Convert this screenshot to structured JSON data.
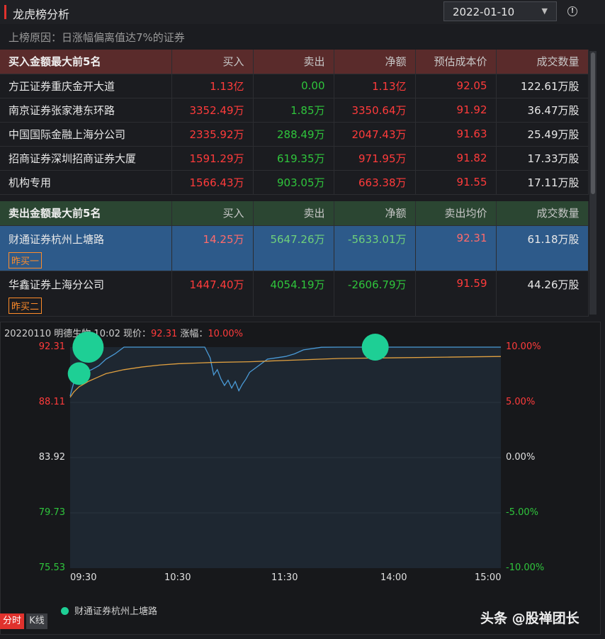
{
  "header": {
    "title": "龙虎榜分析",
    "date": "2022-01-10"
  },
  "reason": "上榜原因：日涨幅偏离值达7%的证券",
  "buy_table": {
    "columns": [
      "买入金额最大前5名",
      "买入",
      "卖出",
      "净额",
      "预估成本价",
      "成交数量"
    ],
    "rows": [
      [
        "方正证券重庆金开大道",
        "1.13亿",
        "0.00",
        "1.13亿",
        "92.05",
        "122.61万股"
      ],
      [
        "南京证券张家港东环路",
        "3352.49万",
        "1.85万",
        "3350.64万",
        "91.92",
        "36.47万股"
      ],
      [
        "中国国际金融上海分公司",
        "2335.92万",
        "288.49万",
        "2047.43万",
        "91.63",
        "25.49万股"
      ],
      [
        "招商证券深圳招商证券大厦",
        "1591.29万",
        "619.35万",
        "971.95万",
        "91.82",
        "17.33万股"
      ],
      [
        "机构专用",
        "1566.43万",
        "903.05万",
        "663.38万",
        "91.55",
        "17.11万股"
      ]
    ]
  },
  "sell_table": {
    "columns": [
      "卖出金额最大前5名",
      "买入",
      "卖出",
      "净额",
      "卖出均价",
      "成交数量"
    ],
    "rows": [
      [
        "财通证券杭州上塘路",
        "14.25万",
        "5647.26万",
        "-5633.01万",
        "92.31",
        "61.18万股"
      ],
      [
        "华鑫证券上海分公司",
        "1447.40万",
        "4054.19万",
        "-2606.79万",
        "91.59",
        "44.26万股"
      ]
    ],
    "tags": [
      "昨买一",
      "昨买二"
    ]
  },
  "chart_info": {
    "prefix": "20220110 明德生物 10:02 现价：",
    "price": "92.31",
    "pct_label": "涨幅：",
    "pct": "10.00%"
  },
  "chart_data": {
    "type": "line",
    "y_left_ticks": [
      "92.31",
      "88.11",
      "83.92",
      "79.73",
      "75.53"
    ],
    "y_right_ticks": [
      "10.00%",
      "5.00%",
      "0.00%",
      "-5.00%",
      "-10.00%"
    ],
    "x_ticks": [
      "09:30",
      "10:30",
      "11:30",
      "14:00",
      "15:00"
    ],
    "ylim": [
      75.53,
      92.31
    ],
    "series": [
      {
        "x": [
          0,
          2,
          5,
          8,
          12,
          16,
          20,
          25,
          30,
          40,
          50,
          60,
          70,
          75,
          78,
          80,
          82,
          84,
          86,
          88,
          90,
          92,
          94,
          96,
          98,
          100,
          105,
          110,
          115,
          120,
          125,
          130,
          140,
          150,
          160,
          180,
          200,
          220,
          240
        ],
        "y": [
          88.6,
          89.6,
          90.1,
          90.4,
          90.6,
          90.9,
          91.4,
          91.8,
          92.31,
          92.31,
          92.31,
          92.31,
          92.31,
          92.31,
          91.5,
          90.2,
          90.6,
          89.9,
          89.4,
          89.8,
          89.2,
          89.7,
          89.0,
          89.5,
          89.9,
          90.4,
          90.9,
          91.4,
          91.5,
          91.6,
          91.8,
          92.1,
          92.3,
          92.31,
          92.31,
          92.31,
          92.31,
          92.31,
          92.31
        ]
      },
      {
        "x": [
          0,
          2,
          5,
          10,
          15,
          20,
          30,
          40,
          50,
          60,
          70,
          80,
          100,
          120,
          150,
          180,
          210,
          240
        ],
        "y": [
          88.5,
          88.9,
          89.3,
          89.7,
          90.0,
          90.3,
          90.6,
          90.8,
          90.95,
          91.05,
          91.1,
          91.15,
          91.2,
          91.3,
          91.45,
          91.5,
          91.55,
          91.6
        ]
      }
    ],
    "markers": [
      {
        "name": "财通证券杭州上塘路",
        "x": 10,
        "y": 92.31
      },
      {
        "name": "财通证券杭州上塘路",
        "x": 5,
        "y": 90.3
      },
      {
        "name": "财通证券杭州上塘路",
        "x": 170,
        "y": 92.31
      }
    ],
    "legend": "财通证券杭州上塘路",
    "colors": {
      "price": "#4a9ad6",
      "avg": "#e0a040",
      "marker": "#1ecf95"
    }
  },
  "tabs": {
    "fenshi": "分时",
    "kline": "K线"
  },
  "watermark": "头条 @股禅团长"
}
